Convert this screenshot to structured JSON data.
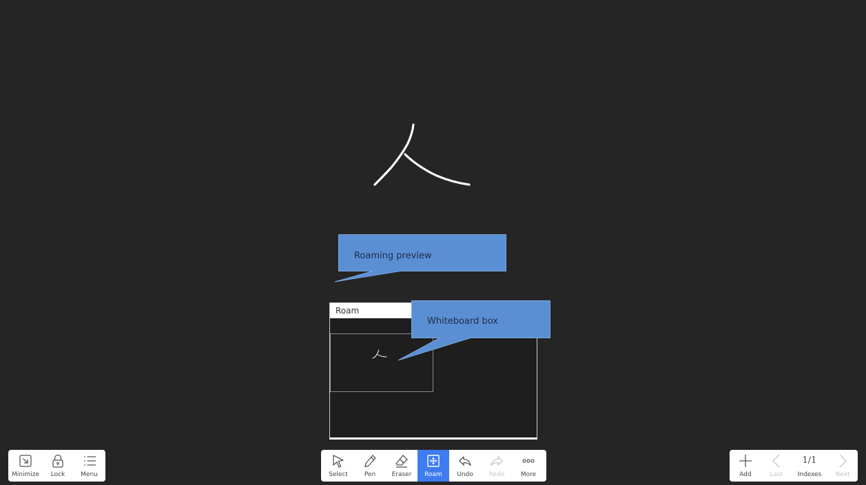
{
  "callouts": {
    "roaming_preview": "Roaming preview",
    "whiteboard_box": "Whiteboard box"
  },
  "roam_panel": {
    "title": "Roam"
  },
  "left_toolbar": {
    "items": [
      {
        "label": "Minimize",
        "icon": "minimize-icon"
      },
      {
        "label": "Lock",
        "icon": "lock-icon"
      },
      {
        "label": "Menu",
        "icon": "menu-icon"
      }
    ]
  },
  "center_toolbar": {
    "active": "Roam",
    "items": [
      {
        "label": "Select",
        "icon": "select-cursor-icon"
      },
      {
        "label": "Pen",
        "icon": "pen-icon"
      },
      {
        "label": "Eraser",
        "icon": "eraser-icon"
      },
      {
        "label": "Roam",
        "icon": "roam-icon"
      },
      {
        "label": "Undo",
        "icon": "undo-icon"
      },
      {
        "label": "Redo",
        "icon": "redo-icon",
        "disabled": true
      },
      {
        "label": "More",
        "icon": "more-icon"
      }
    ]
  },
  "right_toolbar": {
    "items": [
      {
        "label": "Add",
        "icon": "plus-icon"
      },
      {
        "label": "Last",
        "icon": "chevron-left-icon",
        "disabled": true
      },
      {
        "label": "Indexes",
        "page": "1/1"
      },
      {
        "label": "Next",
        "icon": "chevron-right-icon",
        "disabled": true
      }
    ]
  },
  "colors": {
    "canvas": "#252525",
    "callout_fill": "#5b8fd4",
    "active_tool": "#3f7cf2"
  }
}
